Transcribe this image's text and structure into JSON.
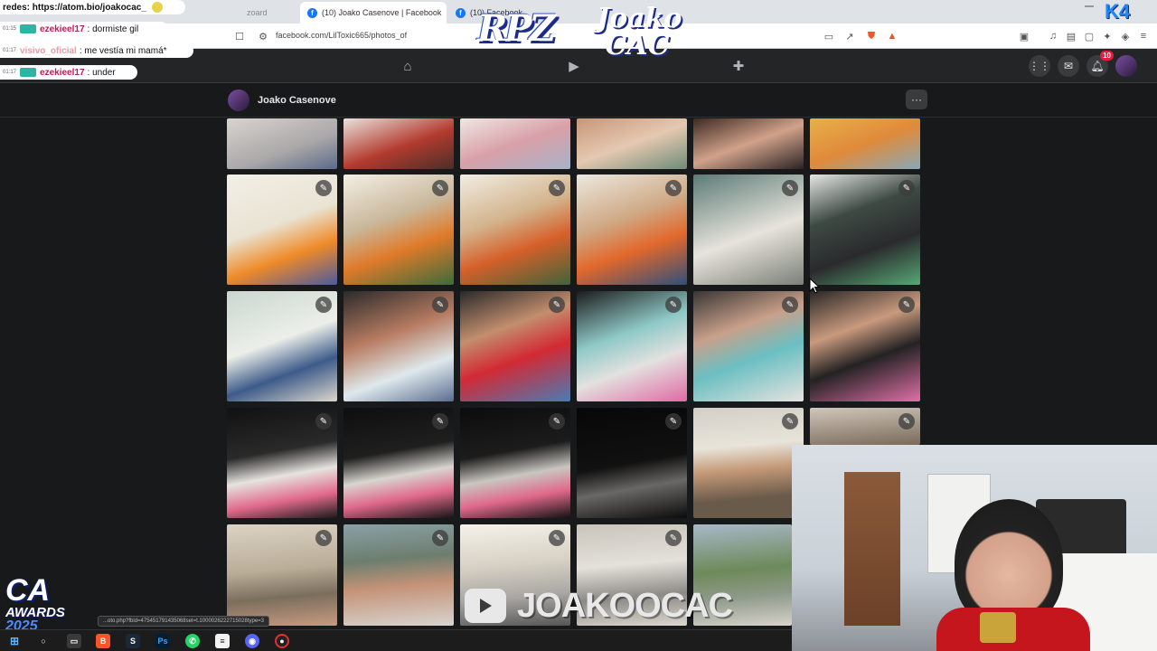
{
  "browser": {
    "tabs": [
      {
        "label": "zoard"
      },
      {
        "label": "(10) Joako Casenove | Facebook",
        "close": "✕"
      },
      {
        "label": "(10) Facebook"
      }
    ],
    "url": "facebook.com/LilToxic665/photos_of"
  },
  "chat": {
    "header": "redes: https://atom.bio/joakocac_",
    "messages": [
      {
        "time": "01:15",
        "user": "ezekieel17",
        "text": ": dormiste gil"
      },
      {
        "time": "01:17",
        "user": "visivo_oficial",
        "text": ": me vestía mi mamá*"
      },
      {
        "time": "01:17",
        "user": "ezekieel17",
        "text": ": under"
      }
    ]
  },
  "overlay": {
    "logo_left": "RPZ",
    "logo_right_1": "Joako",
    "logo_right_2": "CAC",
    "corner_badge": "K4",
    "awards_1": "CA",
    "awards_2": "AWARDS",
    "awards_3": "2025",
    "youtube_handle": "JOAKOOCAC"
  },
  "facebook": {
    "notifications_count": "10",
    "album_owner": "Joako Casenove",
    "more": "···"
  },
  "status_url": "...oto.php?fbid=475451791435068set=t.1000026222715028type=3",
  "icons": {
    "home": "home-icon",
    "video": "video-icon",
    "gaming": "gaming-icon",
    "menu": "grid-menu-icon",
    "messenger": "messenger-icon",
    "bell": "bell-icon",
    "edit": "pencil-icon"
  },
  "colors": {
    "fb_blue": "#1877f2",
    "dark_bg": "#18191a",
    "nav_bg": "#242526",
    "badge_red": "#e41e3f"
  }
}
